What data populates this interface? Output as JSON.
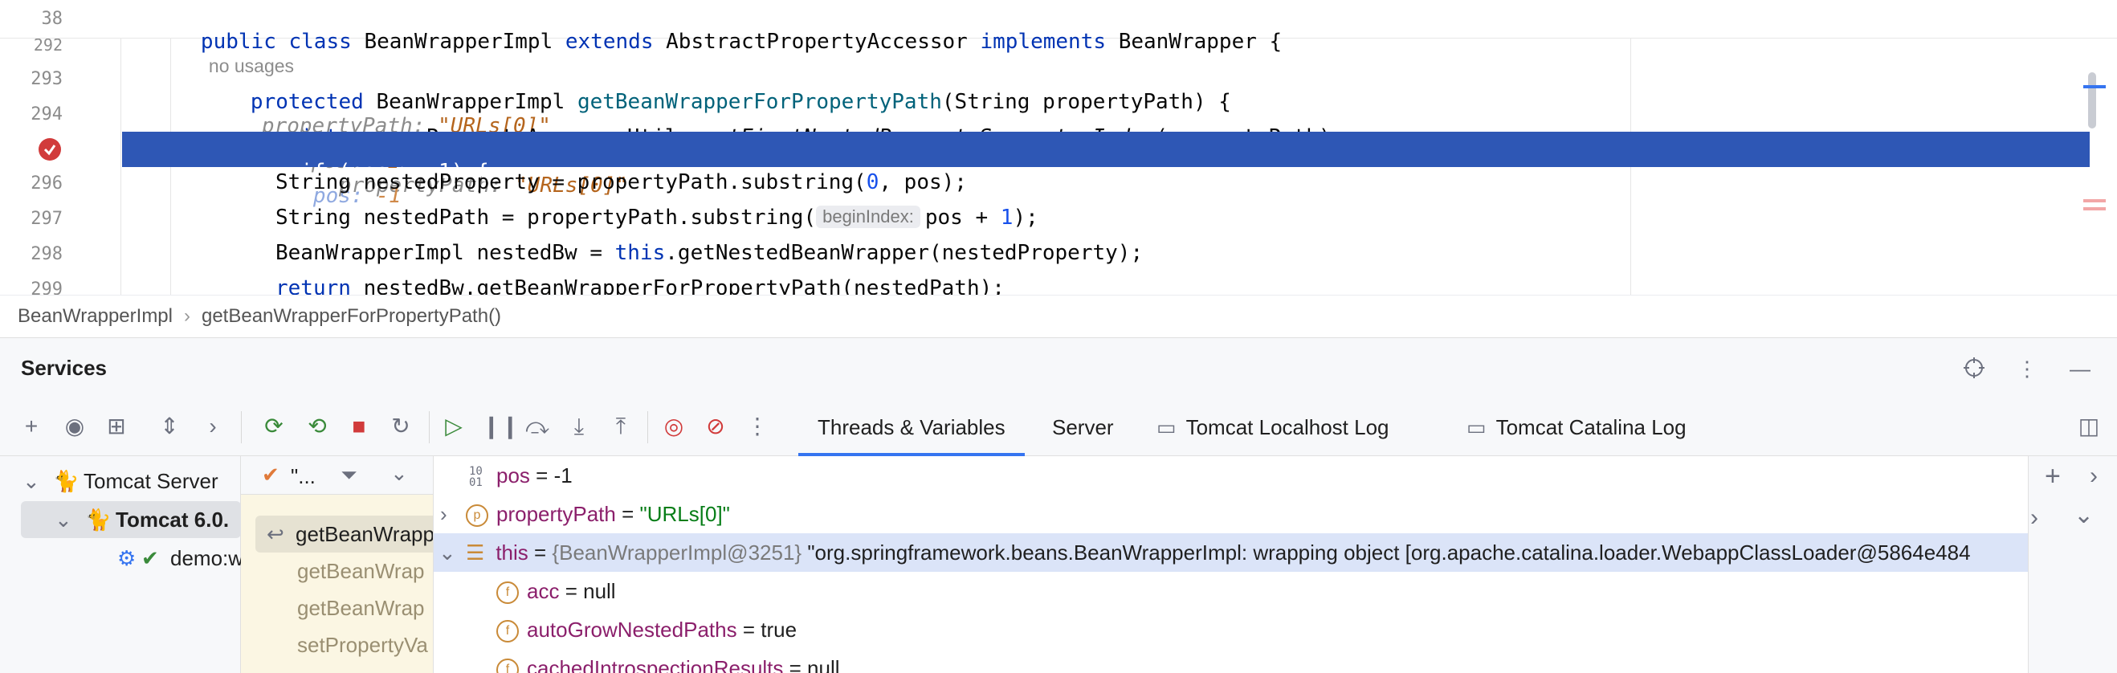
{
  "editor": {
    "sticky": {
      "line_no": "38",
      "kw_public": "public",
      "kw_class": "class",
      "class_name": "BeanWrapperImpl",
      "kw_extends": "extends",
      "parent": "AbstractPropertyAccessor",
      "kw_implements": "implements",
      "iface": "BeanWrapper {",
      "usages": "no usages"
    },
    "lines": [
      {
        "no": "292"
      },
      {
        "no": "293",
        "kw": "protected",
        "type": "BeanWrapperImpl",
        "fn": "getBeanWrapperForPropertyPath",
        "rest": "(String propertyPath) {",
        "hint_name": "propertyPath:",
        "hint_val": "\"URLs[0]\""
      },
      {
        "no": "294",
        "kw": "int",
        "pre": "pos = PropertyAccessorUtils.",
        "fn": "getFirstNestedPropertySeparatorIndex",
        "rest": "(propertyPath);",
        "hint1_name": "pos:",
        "hint1_val": "-1",
        "hint2_name": "propertyPath:",
        "hint2_val": "\"URLs[0]\""
      },
      {
        "no": "295",
        "code": "if (pos > -1) {",
        "hint_name": "pos:",
        "hint_val": "-1"
      },
      {
        "no": "296",
        "pre": "String nestedProperty = propertyPath.substring(",
        "num": "0",
        "rest": ", pos);"
      },
      {
        "no": "297",
        "pre": "String nestedPath = propertyPath.substring(",
        "chip": "beginIndex:",
        "mid": "pos + ",
        "num": "1",
        "rest": ");"
      },
      {
        "no": "298",
        "pre": "BeanWrapperImpl nestedBw = ",
        "kw": "this",
        "rest": ".getNestedBeanWrapper(nestedProperty);"
      },
      {
        "no": "299",
        "kw": "return",
        "rest": "nestedBw.getBeanWrapperForPropertyPath(nestedPath);"
      }
    ]
  },
  "breadcrumb": {
    "class_name": "BeanWrapperImpl",
    "method": "getBeanWrapperForPropertyPath()"
  },
  "services": {
    "title": "Services",
    "tabs": {
      "threads": "Threads & Variables",
      "server": "Server",
      "localhost_log": "Tomcat Localhost Log",
      "catalina_log": "Tomcat Catalina Log"
    },
    "tree": {
      "server": "Tomcat Server",
      "instance": "Tomcat 6.0.",
      "artifact": "demo:w"
    },
    "frames": {
      "filter_label": "\"...",
      "items": [
        "getBeanWrapp",
        "getBeanWrap",
        "getBeanWrap",
        "setPropertyVa"
      ]
    },
    "variables": [
      {
        "name": "pos",
        "eq": " = ",
        "value": "-1"
      },
      {
        "name": "propertyPath",
        "eq": " = ",
        "value": "\"URLs[0]\""
      },
      {
        "name": "this",
        "eq": " = ",
        "ref": "{BeanWrapperImpl@3251}",
        "value": "\"org.springframework.beans.BeanWrapperImpl: wrapping object [org.apache.catalina.loader.WebappClassLoader@5864e484"
      },
      {
        "name": "acc",
        "eq": " = ",
        "value": "null"
      },
      {
        "name": "autoGrowNestedPaths",
        "eq": " = ",
        "value": "true"
      },
      {
        "name": "cachedIntrospectionResults",
        "eq": " = ",
        "value": "null"
      }
    ]
  },
  "colors": {
    "selection": "#2e57b5",
    "accent": "#3574f0",
    "breakpoint": "#d13b3b"
  }
}
